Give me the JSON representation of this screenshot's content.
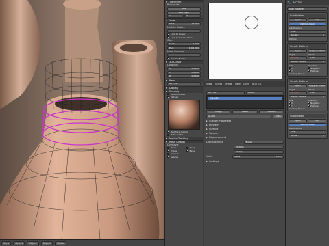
{
  "viewport": {
    "mode": "Object",
    "buttons": [
      "View",
      "Select",
      "Object"
    ],
    "shading_mode": "Global"
  },
  "npanel": {
    "panels": {
      "transform": "Transform",
      "properties": "Properties",
      "view": "View",
      "item": "Item",
      "display": "Display",
      "shading": "Shading",
      "background": "Background Images",
      "transform_orientations": "Transform Orientations",
      "motion_tracking": "Motion Tracking",
      "mesh_display": "Mesh Display"
    },
    "camera": {
      "new_btn": "New",
      "new_layer": "New Layer",
      "layer_vals": [
        "1",
        "2"
      ]
    },
    "view": {
      "lens_label": "Lens:",
      "lens_value": "35.000",
      "lock_label": "Lock to Object:",
      "lock_cursor": "Lock to Cursor",
      "lock_camera": "Lock Camera to View",
      "clip_label": "Clip:",
      "clip_start_label": "Start:",
      "clip_start": "0.100",
      "clip_end_label": "End:",
      "clip_end": "1000.000",
      "local_camera": "Local Camera:",
      "render_border": "Render Border",
      "3d_cursor": "3D Cursor"
    },
    "location": {
      "label": "Location:",
      "x": "0.0000",
      "y": "0.0000",
      "z": "0.0000",
      "x_label": "X:",
      "y_label": "Y:",
      "z_label": "Z:"
    },
    "item": {
      "name": "BOTTLE"
    },
    "shading": {
      "textured_solid": "Textured Solid",
      "matcap": "Matcap",
      "backface": "Backface Culling",
      "hidden_wire": "Hidden Wire"
    },
    "overlays": {
      "label": "Overlays:",
      "faces": "Faces",
      "edges": "Edges",
      "creases": "Creases",
      "seams": "Seams",
      "sharp": "Sharp",
      "bevel": "Bevel"
    }
  },
  "material_panel": {
    "header_items": [
      "View",
      "Select",
      "Image",
      "New",
      "Open",
      "BOTTLE"
    ],
    "object_name": "BOTTLE",
    "glass_name": "GLASS",
    "slots": [
      "GLASS"
    ],
    "buttons": [
      "Assign",
      "Select",
      "Deselect"
    ],
    "data_field": "GLASS",
    "data_label": "Data",
    "sections": [
      "Custom Properties",
      "Preview",
      "Surface",
      "Volume",
      "Displacement"
    ],
    "displacement_label": "Displacement:",
    "displacement_mode": "Bump",
    "multiply_label": "Multiply",
    "clamp_label": "Clamp",
    "value_label": "Value",
    "value": "0.037",
    "settings": "Settings"
  },
  "modifiers": {
    "header_object": "BOTTLE",
    "add_modifier": "Add Modifier",
    "blocks": [
      {
        "name": "Subdivision",
        "apply": "Apply",
        "copy": "Copy",
        "type": "Catmull-Clark",
        "subdiv_label": "Subdivisions:",
        "view_label": "View:",
        "view": "1",
        "render_label": "Render:",
        "render": "2",
        "options_label": "Options:"
      },
      {
        "name": "Simple Deform",
        "apply": "Apply",
        "shape": "Apply as Shape",
        "target_label": "Target:",
        "target": "BOTTLE",
        "offset_label": "Offset:",
        "offset": "0.00",
        "subsurf_label": "Subsurf Levels:",
        "subsurf": "0",
        "axis_label": "Axis:",
        "direction_label": "Direction:",
        "neg": "Negative",
        "pos": "Positive",
        "x": "X",
        "y": "Y",
        "z": "Z",
        "aux_label": "Auxiliary Target:"
      },
      {
        "name": "Simple Deform",
        "apply": "Apply",
        "shape": "Apply as Shape",
        "target_label": "Target:",
        "target": "BOTTLE",
        "offset_label": "Offset:",
        "offset": "0.00",
        "subsurf_label": "Subsurf Levels:",
        "subsurf": "0",
        "axis_label": "Axis:",
        "direction_label": "Direction:",
        "neg": "Negative",
        "pos": "Positive",
        "x": "X",
        "y": "Y",
        "z": "Z",
        "aux_label": "Auxiliary Target:"
      },
      {
        "name": "Subdivision",
        "apply": "Apply",
        "copy": "Copy",
        "type": "Catmull-Clark",
        "subdiv_label": "Subdivisions:",
        "view_label": "View:",
        "view": "1",
        "render_label": "Render:",
        "render": "2",
        "options_label": "Options:"
      }
    ]
  },
  "colors": {
    "selection": "#c838c8",
    "accent": "#5680c2",
    "bottle": "#c99a80"
  }
}
